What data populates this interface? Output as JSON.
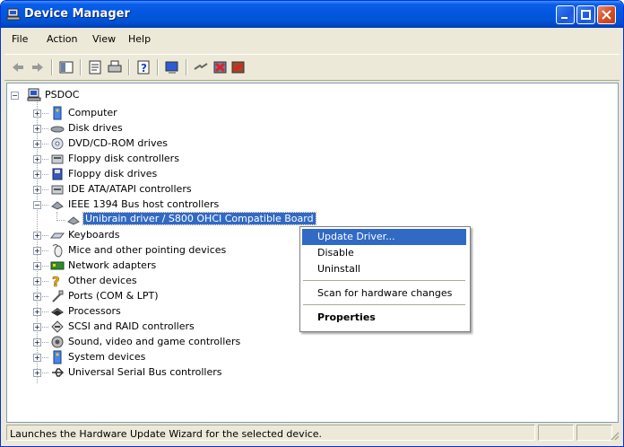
{
  "window": {
    "title": "Device Manager"
  },
  "menu": [
    "File",
    "Action",
    "View",
    "Help"
  ],
  "toolbar": {
    "buttons": [
      "back-icon",
      "forward-icon",
      "show-hide-console-tree-icon",
      "properties-icon",
      "print-icon",
      "help-icon",
      "scan-hardware-icon",
      "update-driver-icon",
      "uninstall-icon",
      "disable-icon"
    ]
  },
  "tree": {
    "root": "PSDOC",
    "items": [
      {
        "label": "Computer",
        "icon": "computer-icon",
        "expanded": false
      },
      {
        "label": "Disk drives",
        "icon": "disk-drive-icon",
        "expanded": false
      },
      {
        "label": "DVD/CD-ROM drives",
        "icon": "cdrom-icon",
        "expanded": false
      },
      {
        "label": "Floppy disk controllers",
        "icon": "floppy-controller-icon",
        "expanded": false
      },
      {
        "label": "Floppy disk drives",
        "icon": "floppy-drive-icon",
        "expanded": false
      },
      {
        "label": "IDE ATA/ATAPI controllers",
        "icon": "ide-controller-icon",
        "expanded": false
      },
      {
        "label": "IEEE 1394 Bus host controllers",
        "icon": "ieee1394-icon",
        "expanded": true,
        "child": "Unibrain driver / S800 OHCI Compatible Board"
      },
      {
        "label": "Keyboards",
        "icon": "keyboard-icon",
        "expanded": false
      },
      {
        "label": "Mice and other pointing devices",
        "icon": "mouse-icon",
        "expanded": false
      },
      {
        "label": "Network adapters",
        "icon": "network-adapter-icon",
        "expanded": false
      },
      {
        "label": "Other devices",
        "icon": "other-devices-icon",
        "expanded": false
      },
      {
        "label": "Ports (COM & LPT)",
        "icon": "ports-icon",
        "expanded": false
      },
      {
        "label": "Processors",
        "icon": "processor-icon",
        "expanded": false
      },
      {
        "label": "SCSI and RAID controllers",
        "icon": "scsi-icon",
        "expanded": false
      },
      {
        "label": "Sound, video and game controllers",
        "icon": "sound-icon",
        "expanded": false
      },
      {
        "label": "System devices",
        "icon": "system-devices-icon",
        "expanded": false
      },
      {
        "label": "Universal Serial Bus controllers",
        "icon": "usb-icon",
        "expanded": false
      }
    ]
  },
  "context_menu": {
    "items": [
      {
        "label": "Update Driver...",
        "highlighted": true
      },
      {
        "label": "Disable"
      },
      {
        "label": "Uninstall"
      },
      {
        "label": "Scan for hardware changes"
      },
      {
        "label": "Properties",
        "bold": true
      }
    ]
  },
  "status": {
    "text": "Launches the Hardware Update Wizard for the selected device."
  },
  "colors": {
    "titlebar": "#0256e0",
    "selection": "#316ac5",
    "close_button": "#d7502c"
  }
}
